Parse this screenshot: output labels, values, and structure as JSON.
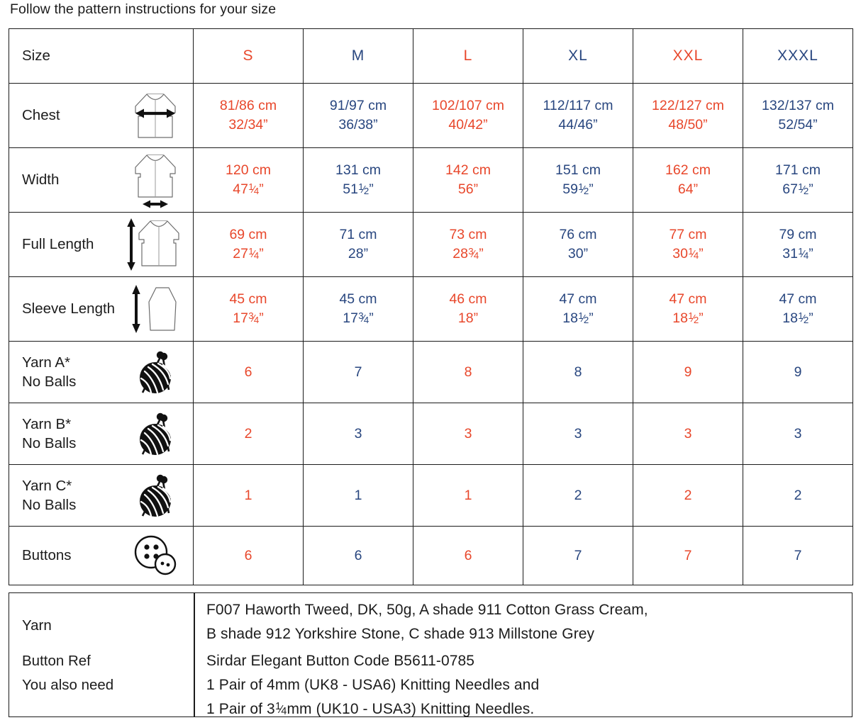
{
  "intro": "Follow the pattern instructions for your size",
  "table": {
    "size_row_label": "Size",
    "sizes": [
      {
        "label": "S",
        "color": "#e8472b"
      },
      {
        "label": "M",
        "color": "#28467f"
      },
      {
        "label": "L",
        "color": "#e8472b"
      },
      {
        "label": "XL",
        "color": "#28467f"
      },
      {
        "label": "XXL",
        "color": "#e8472b"
      },
      {
        "label": "XXXL",
        "color": "#28467f"
      }
    ],
    "rows": [
      {
        "label": "Chest",
        "icon": "cardigan-chest-width-icon",
        "values_cm": [
          "81/86 cm",
          "91/97 cm",
          "102/107 cm",
          "112/117 cm",
          "122/127 cm",
          "132/137 cm"
        ],
        "values_in": [
          "32/34”",
          "36/38”",
          "40/42”",
          "44/46”",
          "48/50”",
          "52/54”"
        ]
      },
      {
        "label": "Width",
        "icon": "cardigan-hem-width-icon",
        "values_cm": [
          "120 cm",
          "131 cm",
          "142 cm",
          "151 cm",
          "162 cm",
          "171 cm"
        ],
        "values_in": [
          "47¼”",
          "51½”",
          "56”",
          "59½”",
          "64”",
          "67½”"
        ]
      },
      {
        "label": "Full Length",
        "icon": "cardigan-full-length-icon",
        "values_cm": [
          "69 cm",
          "71 cm",
          "73 cm",
          "76 cm",
          "77 cm",
          "79 cm"
        ],
        "values_in": [
          "27¼”",
          "28”",
          "28¾”",
          "30”",
          "30¼”",
          "31¼”"
        ]
      },
      {
        "label": "Sleeve Length",
        "icon": "sleeve-length-icon",
        "values_cm": [
          "45 cm",
          "45 cm",
          "46 cm",
          "47 cm",
          "47 cm",
          "47 cm"
        ],
        "values_in": [
          "17¾”",
          "17¾”",
          "18”",
          "18½”",
          "18½”",
          "18½”"
        ]
      }
    ],
    "yarn_rows": [
      {
        "label_line1": "Yarn A*",
        "label_line2": "No Balls",
        "icon": "yarn-ball-icon",
        "counts": [
          "6",
          "7",
          "8",
          "8",
          "9",
          "9"
        ]
      },
      {
        "label_line1": "Yarn B*",
        "label_line2": "No Balls",
        "icon": "yarn-ball-icon",
        "counts": [
          "2",
          "3",
          "3",
          "3",
          "3",
          "3"
        ]
      },
      {
        "label_line1": "Yarn C*",
        "label_line2": "No Balls",
        "icon": "yarn-ball-icon",
        "counts": [
          "1",
          "1",
          "1",
          "2",
          "2",
          "2"
        ]
      }
    ],
    "buttons_row": {
      "label": "Buttons",
      "icon": "buttons-icon",
      "counts": [
        "6",
        "6",
        "6",
        "7",
        "7",
        "7"
      ]
    }
  },
  "info": {
    "labels": {
      "yarn": "Yarn",
      "button_ref": "Button Ref",
      "you_also_need": "You also need"
    },
    "yarn_line1": "F007 Haworth Tweed, DK, 50g, A shade 911 Cotton Grass Cream,",
    "yarn_line2": "B shade 912 Yorkshire Stone, C shade 913 Millstone Grey",
    "button_ref": "Sirdar Elegant Button Code B5611-0785",
    "need_line1": "1 Pair of 4mm (UK8 - USA6) Knitting Needles and",
    "need_line2_pre": "1 Pair of 3",
    "need_line2_frac": "¼",
    "need_line2_post": "mm (UK10 - USA3) Knitting Needles."
  },
  "colors": {
    "red": "#e8472b",
    "blue": "#28467f",
    "border": "#1b1b1b",
    "text": "#1c1c1c"
  }
}
